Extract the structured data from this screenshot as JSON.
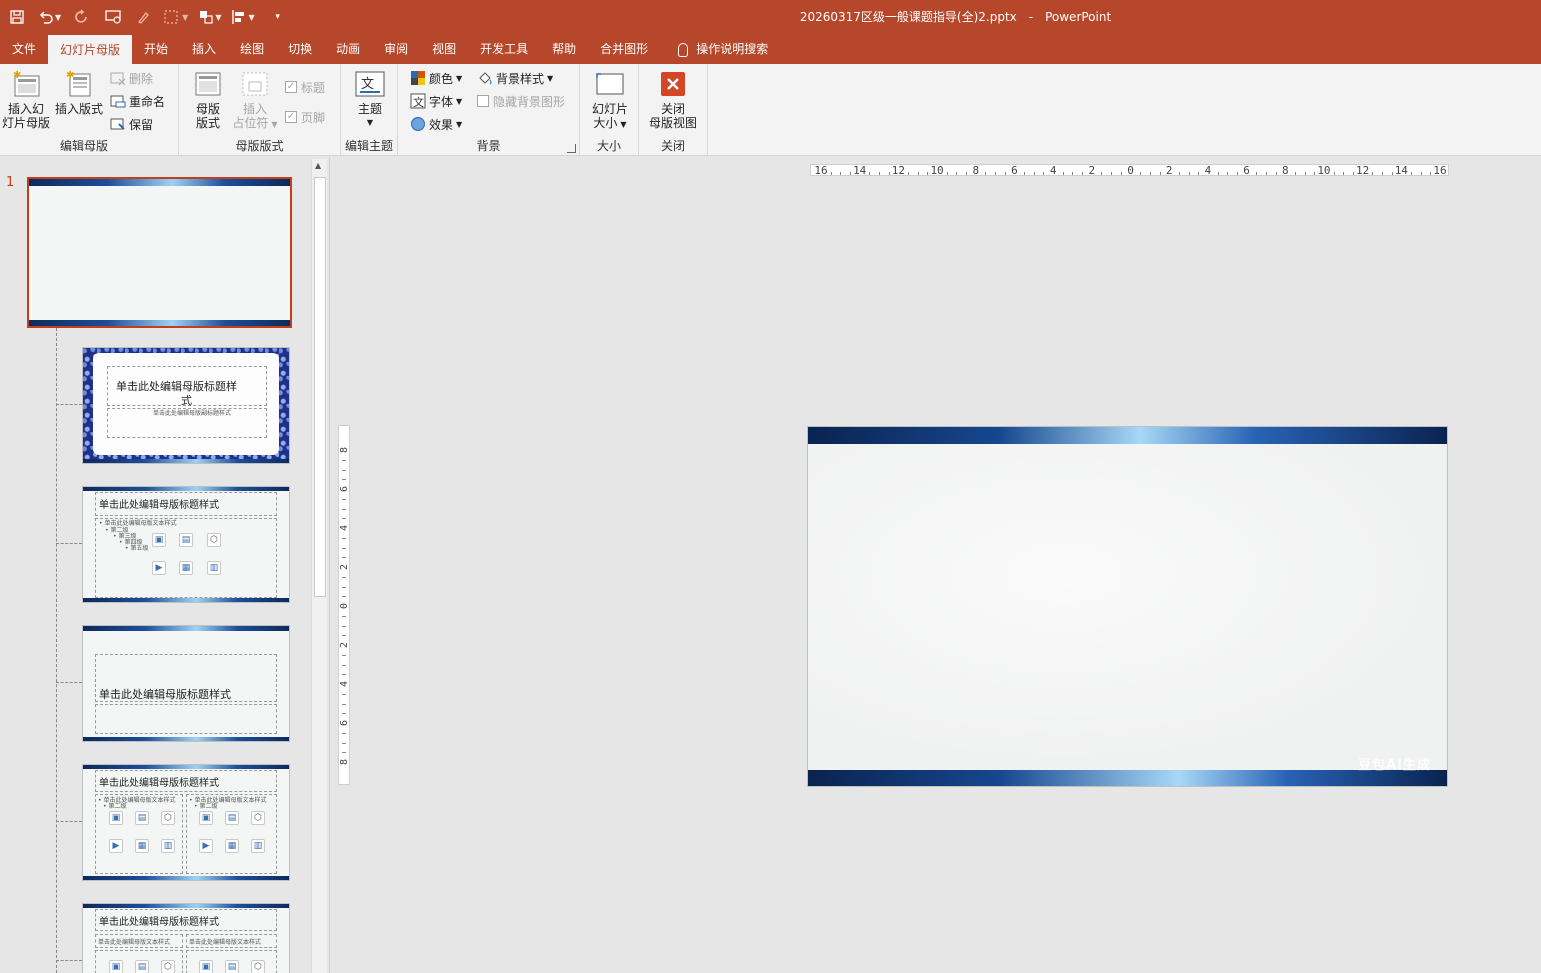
{
  "app": {
    "title": "20260317区级一般课题指导(全)2.pptx",
    "separator": "-",
    "name": "PowerPoint"
  },
  "tabs": [
    {
      "label": "文件"
    },
    {
      "label": "幻灯片母版",
      "active": true
    },
    {
      "label": "开始"
    },
    {
      "label": "插入"
    },
    {
      "label": "绘图"
    },
    {
      "label": "切换"
    },
    {
      "label": "动画"
    },
    {
      "label": "审阅"
    },
    {
      "label": "视图"
    },
    {
      "label": "开发工具"
    },
    {
      "label": "帮助"
    },
    {
      "label": "合并图形"
    },
    {
      "label": "操作说明搜索"
    }
  ],
  "ribbon": {
    "edit_master": {
      "label": "编辑母版",
      "insert_master_line1": "插入幻",
      "insert_master_line2": "灯片母版",
      "insert_layout": "插入版式",
      "delete": "删除",
      "rename": "重命名",
      "preserve": "保留"
    },
    "master_layout": {
      "label": "母版版式",
      "master_layout_line1": "母版",
      "master_layout_line2": "版式",
      "insert_placeholder_line1": "插入",
      "insert_placeholder_line2": "占位符",
      "title_chk": "标题",
      "footer_chk": "页脚"
    },
    "edit_theme": {
      "label": "编辑主题",
      "theme": "主题"
    },
    "background": {
      "label": "背景",
      "colors": "颜色",
      "fonts": "字体",
      "effects": "效果",
      "bg_styles": "背景样式",
      "hide_bg": "隐藏背景图形"
    },
    "size": {
      "label": "大小",
      "slide_size_line1": "幻灯片",
      "slide_size_line2": "大小"
    },
    "close": {
      "label": "关闭",
      "close_line1": "关闭",
      "close_line2": "母版视图"
    }
  },
  "thumbnails": {
    "slide_number": "1",
    "layout1_title_l1": "单击此处编辑母版标题样",
    "layout1_title_l2": "式",
    "layout1_sub": "单击此处编辑母版副标题样式",
    "layout2_title": "单击此处编辑母版标题样式",
    "layout2_body": "• 单击此处编辑母版文本样式",
    "layout2_l2": "• 第二级",
    "layout2_l3": "• 第三级",
    "layout2_l4": "• 第四级",
    "layout2_l5": "• 第五级",
    "layout3_title": "单击此处编辑母版标题样式",
    "layout4_title": "单击此处编辑母版标题样式",
    "layout4_body": "• 单击此处编辑母版文本样式",
    "layout4_l2": "• 第二级",
    "layout5_title": "单击此处编辑母版标题样式",
    "layout5_body": "单击此处编辑母版文本样式"
  },
  "ruler": {
    "h_labels": [
      "16",
      "14",
      "12",
      "10",
      "8",
      "6",
      "4",
      "2",
      "0",
      "2",
      "4",
      "6",
      "8",
      "10",
      "12",
      "14",
      "16"
    ],
    "v_labels": [
      "8",
      "6",
      "4",
      "2",
      "0",
      "2",
      "4",
      "6",
      "8"
    ]
  },
  "slide": {
    "watermark": "豆包AI生成"
  },
  "colors": {
    "accent": "#b7472a",
    "selected_border": "#c43e1c",
    "slide_bar": "#17478f"
  }
}
